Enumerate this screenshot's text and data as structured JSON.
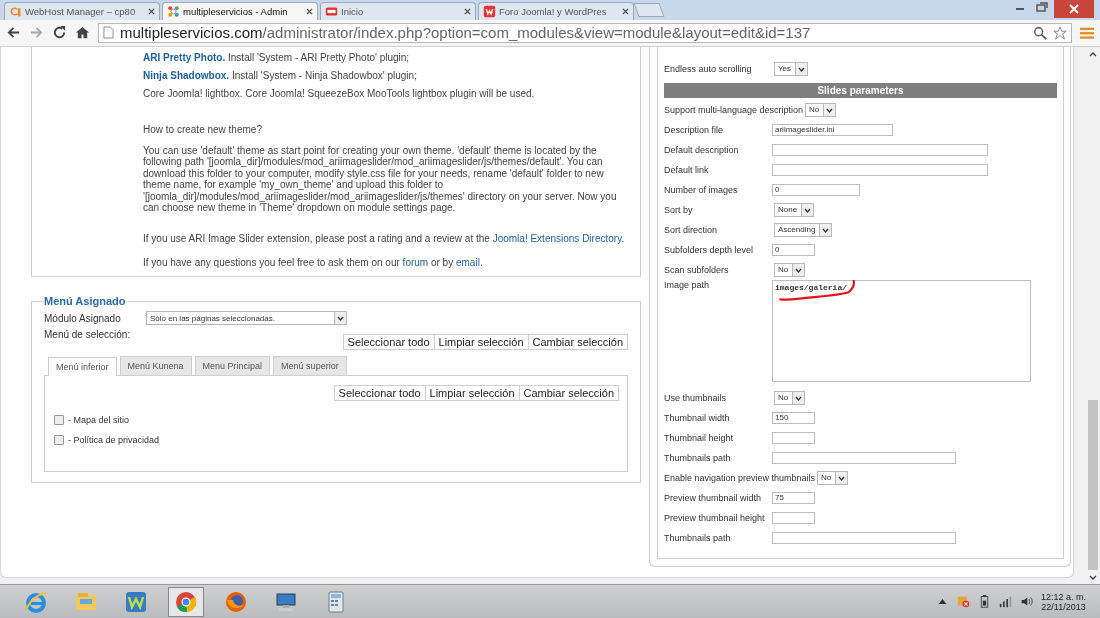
{
  "browser": {
    "tabs": [
      {
        "title": "WebHost Manager – cp80",
        "selected": false,
        "kind": "cpanel"
      },
      {
        "title": "multipleservicios - Admin",
        "selected": true,
        "kind": "joomla"
      },
      {
        "title": "Inicio",
        "selected": false,
        "kind": "site"
      },
      {
        "title": "Foro Joomla! y WordPres",
        "selected": false,
        "kind": "forum"
      }
    ],
    "address": {
      "host": "multipleservicios.com",
      "path": "/administrator/index.php?option=com_modules&view=module&layout=edit&id=137"
    }
  },
  "description": [
    {
      "kind": "plugin",
      "parts": [
        {
          "link": "ARI Pretty Photo."
        },
        {
          "text": " Install 'System - ARI Pretty Photo' plugin;"
        }
      ]
    },
    {
      "kind": "plugin",
      "parts": [
        {
          "link": "Ninja Shadowbox."
        },
        {
          "text": " Install 'System - Ninja Shadowbox' plugin;"
        }
      ]
    },
    {
      "kind": "plugin",
      "parts": [
        {
          "text": "Core Joomla! lightbox. Core Joomla! SqueezeBox MooTools lightbox plugin will be used."
        }
      ]
    },
    {
      "kind": "heading",
      "parts": [
        {
          "text": "How to create new theme?"
        }
      ]
    },
    {
      "kind": "body",
      "parts": [
        {
          "text": "You can use 'default' theme as start point for creating your own theme. 'default' theme is located by the following path '[joomla_dir]/modules/mod_ariimageslider/mod_ariimageslider/js/themes/default'. You can download this folder to your computer, modify style.css file for your needs, rename 'default' folder to new theme name, for example 'my_own_theme' and upload this folder to '[joomla_dir]/modules/mod_ariimageslider/mod_ariimageslider/js/themes' directory on your server. Now you can choose new theme in 'Theme' dropdown on module settings page."
        }
      ]
    },
    {
      "kind": "note",
      "parts": [
        {
          "text": "If you use ARI Image Slider extension, please post a rating and a review at the "
        },
        {
          "link": "Joomla! Extensions Directory"
        },
        {
          "text": "."
        }
      ]
    },
    {
      "kind": "body",
      "parts": [
        {
          "text": "If you have any questions you feel free to ask them on our "
        },
        {
          "link": "forum"
        },
        {
          "text": " or by "
        },
        {
          "link": "email"
        },
        {
          "text": "."
        }
      ]
    }
  ],
  "menu_assignment": {
    "legend": "Menú Asignado",
    "module_label": "Módulo Asignado",
    "module_value": "Sólo en las páginas seleccionadas.",
    "selection_label": "Menú de selección:",
    "buttons": [
      "Seleccionar todo",
      "Limpiar selección",
      "Cambiar selección"
    ],
    "tabs": [
      {
        "label": "Menú inferior",
        "selected": true
      },
      {
        "label": "Menú Kunena",
        "selected": false
      },
      {
        "label": "Menu Principal",
        "selected": false
      },
      {
        "label": "Menú superior",
        "selected": false
      }
    ],
    "tab_buttons": [
      "Seleccionar todo",
      "Limpiar selección",
      "Cambiar selección"
    ],
    "items": [
      {
        "label": "- Mapa del sitio",
        "checked": false
      },
      {
        "label": "- Política de privacidad",
        "checked": false
      }
    ]
  },
  "settings": [
    {
      "kind": "select",
      "label": "Endless auto scrolling",
      "value": "Yes"
    },
    {
      "kind": "header",
      "label": "Slides parameters"
    },
    {
      "kind": "select",
      "label": "Support multi-language description",
      "value": "No"
    },
    {
      "kind": "text-medium",
      "label": "Description file",
      "value": "ariimageslider.ini"
    },
    {
      "kind": "text-long",
      "label": "Default description"
    },
    {
      "kind": "text-long",
      "label": "Default link"
    },
    {
      "kind": "text-medium",
      "label": "Number of images",
      "value": "0"
    },
    {
      "kind": "select",
      "label": "Sort by",
      "value": "None"
    },
    {
      "kind": "select",
      "label": "Sort direction",
      "value": "Ascending"
    },
    {
      "kind": "text-short",
      "label": "Subfolders depth level",
      "value": "0"
    },
    {
      "kind": "select",
      "label": "Scan subfolders",
      "value": "No"
    },
    {
      "kind": "textarea",
      "label": "Image path",
      "value": "images/galeria/"
    },
    {
      "kind": "select",
      "label": "Use thumbnails",
      "value": "No"
    },
    {
      "kind": "text-short",
      "label": "Thumbnail width",
      "value": "150"
    },
    {
      "kind": "text-short",
      "label": "Thumbnail height"
    },
    {
      "kind": "text-wide",
      "label": "Thumbnails path"
    },
    {
      "kind": "select",
      "label": "Enable navigation preview thumbnails",
      "value": "No"
    },
    {
      "kind": "text-short",
      "label": "Preview thumbnail width",
      "value": "75"
    },
    {
      "kind": "text-short",
      "label": "Preview thumbnail height"
    },
    {
      "kind": "text-wide",
      "label": "Thumbnails path"
    }
  ],
  "taskbar": {
    "apps": [
      {
        "kind": "ie",
        "selected": false
      },
      {
        "kind": "explorer",
        "selected": false
      },
      {
        "kind": "w",
        "selected": false
      },
      {
        "kind": "chrome",
        "selected": true
      },
      {
        "kind": "firefox",
        "selected": false
      },
      {
        "kind": "monitor",
        "selected": false
      },
      {
        "kind": "calculator",
        "selected": false
      }
    ],
    "time": "12:12 a. m.",
    "date": "22/11/2013"
  }
}
